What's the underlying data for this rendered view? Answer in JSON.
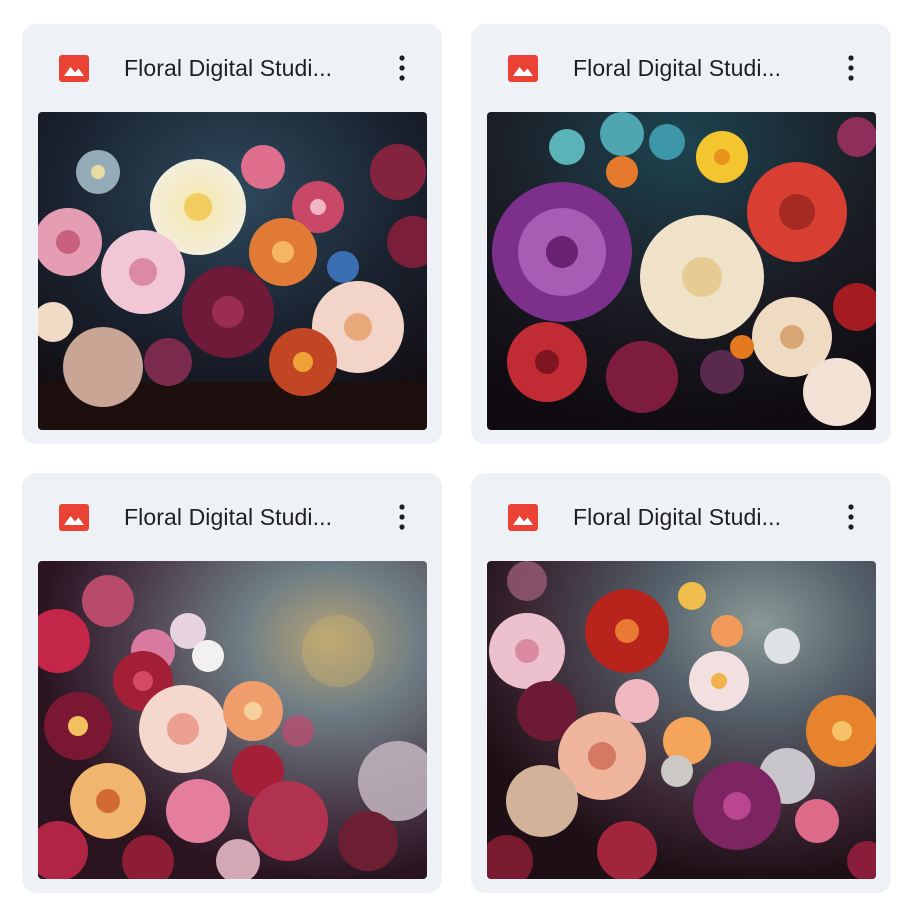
{
  "files": [
    {
      "title": "Floral Digital Studi...",
      "file_type_icon": "image-icon",
      "menu_icon": "more-vert-icon",
      "thumbnail": "dark-floral-bouquet-1"
    },
    {
      "title": "Floral Digital Studi...",
      "file_type_icon": "image-icon",
      "menu_icon": "more-vert-icon",
      "thumbnail": "dark-floral-bouquet-2"
    },
    {
      "title": "Floral Digital Studi...",
      "file_type_icon": "image-icon",
      "menu_icon": "more-vert-icon",
      "thumbnail": "dark-floral-bouquet-3"
    },
    {
      "title": "Floral Digital Studi...",
      "file_type_icon": "image-icon",
      "menu_icon": "more-vert-icon",
      "thumbnail": "dark-floral-bouquet-4"
    }
  ],
  "colors": {
    "card_background": "#eef1f6",
    "image_icon_red": "#ea4335",
    "title_text": "#1f1f1f"
  }
}
